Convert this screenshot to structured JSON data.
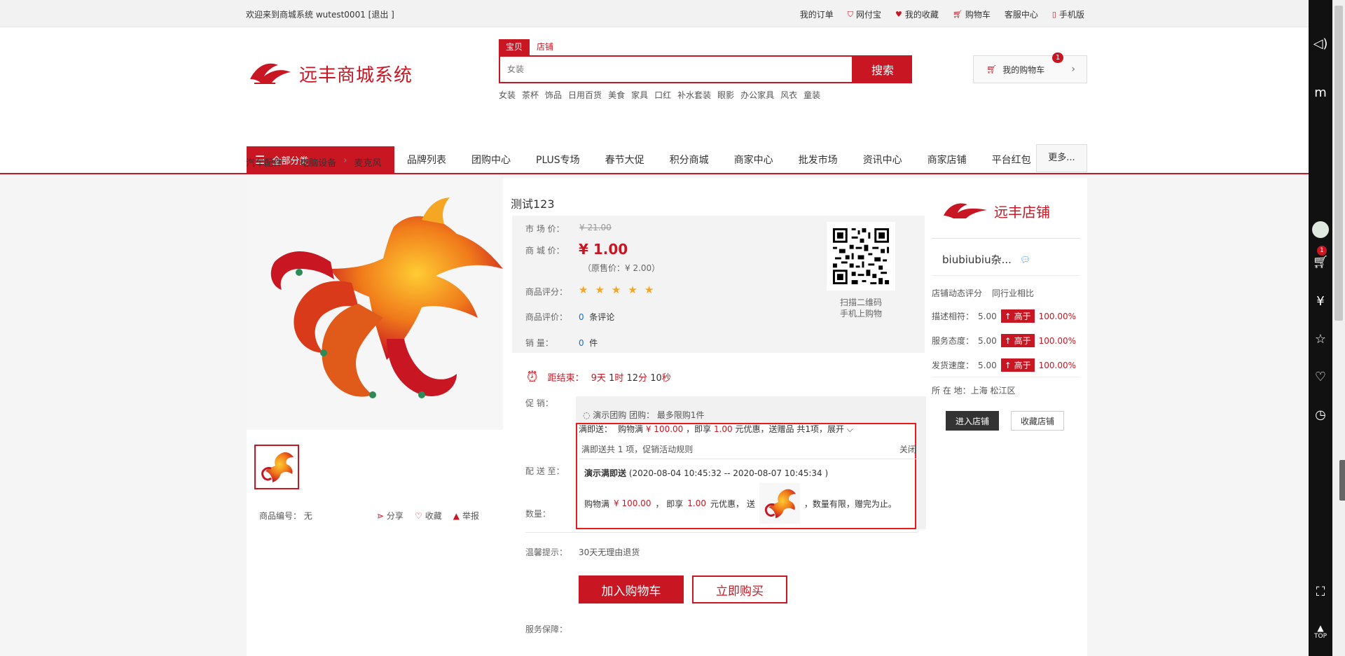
{
  "topbar": {
    "welcome": "欢迎来到商城系统 ",
    "username": "wutest0001",
    "logout": "[退出 ]",
    "links": [
      "我的订单",
      "网付宝",
      "我的收藏",
      "购物车",
      "客服中心",
      "手机版"
    ]
  },
  "header": {
    "logo_text": "远丰商城系统",
    "search_tabs": [
      "宝贝",
      "店铺"
    ],
    "search_placeholder": "女装",
    "search_button": "搜索",
    "hotwords": [
      "女装",
      "茶杯",
      "饰品",
      "日用百货",
      "美食",
      "家具",
      "口红",
      "补水套装",
      "眼影",
      "办公家具",
      "风衣",
      "童装"
    ],
    "cart_label": "我的购物车",
    "cart_count": "1"
  },
  "nav": {
    "all_categories": "全部分类",
    "items": [
      "品牌列表",
      "团购中心",
      "PLUS专场",
      "春节大促",
      "积分商城",
      "商家中心",
      "批发市场",
      "资讯中心",
      "商家店铺",
      "平台红包"
    ],
    "more": "更多..."
  },
  "breadcrumb": [
    "汽车配件",
    "电脑设备",
    "麦克风"
  ],
  "product": {
    "title": "测试123",
    "market_price_label": "市 场 价：",
    "market_price": "¥ 21.00",
    "mall_price_label": "商 城 价：",
    "mall_price": "¥ 1.00",
    "original_price": "（原售价：¥ 2.00）",
    "rating_label": "商品评分：",
    "rating_stars": 5,
    "review_label": "商品评价：",
    "review_count": "0",
    "review_unit": "条评论",
    "sales_label": "销       量：",
    "sales_count": "0",
    "sales_unit": "件",
    "qr_text_1": "扫描二维码",
    "qr_text_2": "手机上购物",
    "countdown_label": "距结束：",
    "countdown": {
      "days": "9",
      "days_unit": "天",
      "hours": "1",
      "hours_unit": "时",
      "minutes": "12",
      "minutes_unit": "分",
      "seconds": "10",
      "seconds_unit": "秒"
    },
    "promo_label": "促       销：",
    "promo_line": "◌ 演示团购 团购：   最多限购1件",
    "delivery_label": "配 送 至：",
    "quantity_label": "数量：",
    "tip_label": "温馨提示：",
    "tip_value": "30天无理由退货",
    "service_label": "服务保障：",
    "add_to_cart": "加入购物车",
    "buy_now": "立即购买",
    "code_label": "商品编号：",
    "code_value": "无",
    "share": "分享",
    "favorite": "收藏",
    "report": "举报"
  },
  "promo_popup": {
    "type": "满即送：",
    "summary_pre": "购物满",
    "summary_amount": "¥ 100.00",
    "summary_mid": "，即享",
    "summary_discount": "1.00",
    "summary_post": "元优惠，送赠品 共1项，展开",
    "sub_text": "满即送共 1 项，促销活动规则",
    "close": "关闭",
    "title": "演示满即送",
    "period": " (2020-08-04 10:45:32 -- 2020-08-07 10:45:34 )",
    "detail_pre": "购物满",
    "detail_amount": "¥ 100.00",
    "detail_mid": "，  即享",
    "detail_discount": "1.00",
    "detail_mid2": "元优惠，  送",
    "detail_post": "，数量有限，赠完为止。"
  },
  "shop": {
    "logo_text": "远丰店铺",
    "name": "biubiubiu杂...",
    "dyn_label": "店铺动态评分",
    "compare_label": "同行业相比",
    "scores": [
      {
        "label": "描述相符：",
        "value": "5.00",
        "badge": "高于",
        "pct": "100.00%"
      },
      {
        "label": "服务态度：",
        "value": "5.00",
        "badge": "高于",
        "pct": "100.00%"
      },
      {
        "label": "发货速度：",
        "value": "5.00",
        "badge": "高于",
        "pct": "100.00%"
      }
    ],
    "location": "所 在 地：上海 松江区",
    "enter": "进入店铺",
    "follow": "收藏店铺"
  },
  "sidebar": {
    "cart_badge": "1",
    "top_label": "TOP"
  },
  "colors": {
    "brand": "#c81623",
    "highlight_border": "#e81c1c"
  }
}
